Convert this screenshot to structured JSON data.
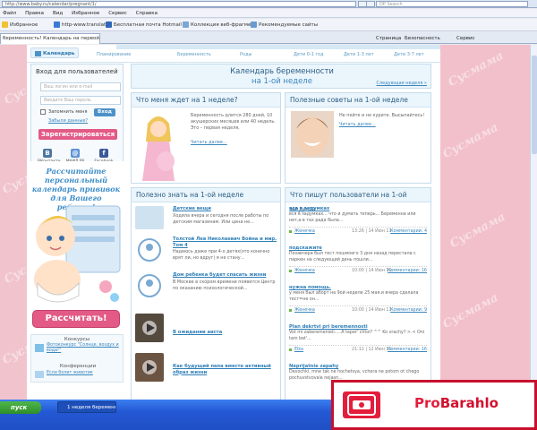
{
  "browser": {
    "address": "http://www.baby.ru/calendar/pregnant/1/",
    "search_placeholder": "DP Search",
    "menu": [
      "Файл",
      "Правка",
      "Вид",
      "Избранное",
      "Сервис",
      "Справка"
    ],
    "favorites_label": "Избранное",
    "favorites": [
      "http-www.translate",
      "Бесплатная почта Hotmail",
      "Коллекция веб-фрагме...",
      "Рекомендуемые сайты"
    ],
    "tab_title": "беременность! Календарь на первой нед...",
    "tools": [
      "Страница",
      "Безопасность",
      "Сервис"
    ]
  },
  "site": {
    "watermark": "Сусмама",
    "nav": {
      "calendar": "Календарь",
      "links": [
        "Планирование",
        "Беременность",
        "Роды",
        "Дети 0-1 год",
        "Дети 1-3 лет",
        "Дети 3-7 лет",
        "Для мам"
      ]
    },
    "login": {
      "title": "Вход для пользователей",
      "email_placeholder": "Ваш логин или e-mail",
      "password_placeholder": "Введите Ваш пароль",
      "remember": "Запомнить меня",
      "enter_btn": "Вход",
      "forgot": "Забыли данные?",
      "register_btn": "Зарегистрироваться",
      "social": [
        "ВКонтакте",
        "МАИЛ.РУ",
        "Facebook"
      ]
    },
    "promo": {
      "title": "Рассчитайте персональный календарь прививок для Вашего ребенка!",
      "button": "Рассчитать!"
    },
    "contests": {
      "title": "Конкурсы",
      "item1": "Фотоконкурс \"Солнце, воздух и вода!\"",
      "conf_title": "Конференции",
      "item2": "Если болит животик"
    },
    "calendar": {
      "line1": "Календарь беременности",
      "line2": "на 1-ой неделе",
      "next": "Следующая неделя »"
    },
    "what": {
      "title": "Что меня ждет на 1 неделе?",
      "text": "Беременность длится 280 дней, 10 акушерских месяцев или 40 недель. Это – первая неделя,",
      "more": "Читать далее..."
    },
    "tips": {
      "title": "Полезные советы на 1-ой неделе",
      "text": "Не пейте и не курите. Высыпайтесь!",
      "more": "Читать далее..."
    },
    "useful": {
      "title": "Полезно знать на 1-ой неделе",
      "items": [
        {
          "title": "Детские вещи",
          "text": "Ходила вчера и сегодня после работы по детским магазинам. Или цена не..."
        },
        {
          "title": "Толстой Лев Николаевич Война и мир. Том 4",
          "text": "Надеюсь даже при 4-х детях(это конечно врят ли, но вдруг) я не стану..."
        },
        {
          "title": "Дом ребенка будет спасать жизни",
          "text": "В Москве в скором времени появится Центр по оказанию психологической..."
        },
        {
          "title": "В ожидании аиста",
          "text": ""
        },
        {
          "title": "Как будущий папа вместе активный образ жизни",
          "text": ""
        }
      ]
    },
    "users": {
      "title": "Что пишут пользователи на 1-ой неделе",
      "posts": [
        {
          "title": "вся в задумках",
          "text": "вся в задумках... что и думать теперь... Беременна или нет,а в тах рада была...",
          "author": "Женечка",
          "date": "13:26 | 14 Июн 11",
          "comments": "Комментарии: 4"
        },
        {
          "title": "подскажите",
          "text": "Позавчера был тест пошмоего 3 дня назад перестала с паркен на следующий день пошли...",
          "author": "Женечка",
          "date": "10:00 | 14 Июн 11",
          "comments": "Комментарии: 16"
        },
        {
          "title": "нужна помощь.",
          "text": "у меня был аборт на 9ой неделе 25 мая.и вчера сделала тест=не он...",
          "author": "Женечка",
          "date": "10:00 | 14 Июн 11",
          "comments": "Комментарии: 9"
        },
        {
          "title": "Plan dekrtvi pri beremennosti",
          "text": "Vot mi zaberemenieli.....A teper' chtol? ^^ Ko vrachy? >.< Oni tam bet'...",
          "author": "Elka",
          "date": "21:11 | 12 Июн 11",
          "comments": "Комментарии: 16"
        },
        {
          "title": "Neprijatnie zapahy",
          "text": "Devochki, mne tak ne hochetsya, vchera ne potom ot chego pochuvstvovala nejasn...",
          "author": "",
          "date": "",
          "comments": ""
        }
      ]
    }
  },
  "taskbar": {
    "start": "пуск",
    "window": "1 неделя беременно..."
  },
  "ad": {
    "brand_pro": "Pro",
    "brand_rest": "Barahlo"
  },
  "colors": {
    "brand_blue": "#3a86bd",
    "pink_bg": "#f1c4cd",
    "button_pink": "#e35a86",
    "ad_red": "#d3102e"
  }
}
